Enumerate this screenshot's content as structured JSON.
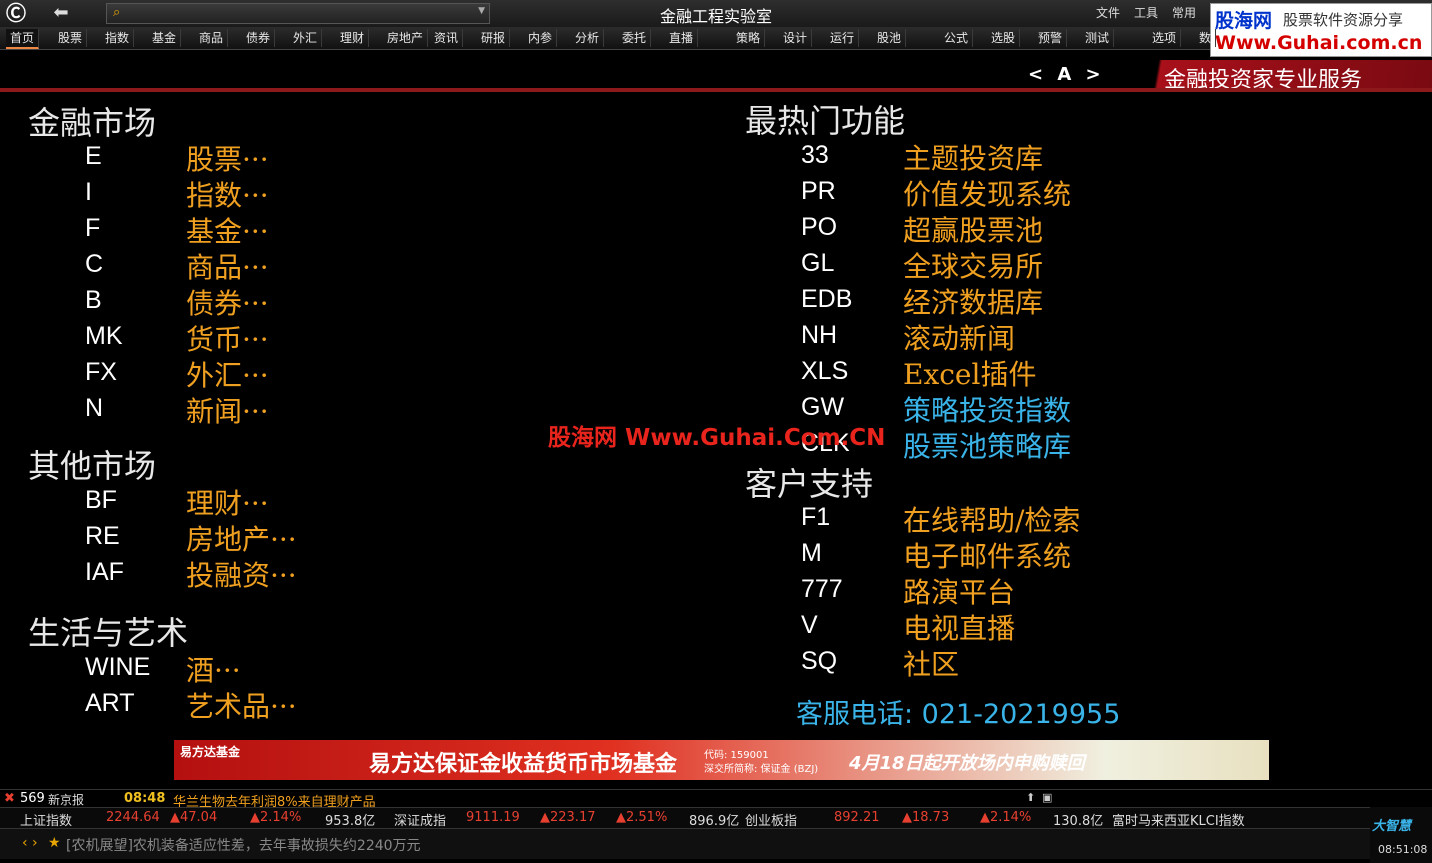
{
  "app": {
    "title": "金融工程实验室"
  },
  "top_menu": [
    "文件",
    "工具",
    "常用"
  ],
  "search": {
    "placeholder": ""
  },
  "brand": {
    "line1": "股海网",
    "line2": "股票软件资源分享",
    "line3": "Www.Guhai.com.cn"
  },
  "tabs": [
    "首页",
    "股票",
    "指数",
    "基金",
    "商品",
    "债券",
    "外汇",
    "理财",
    "房地产",
    "资讯",
    "研报",
    "内参",
    "分析",
    "委托",
    "直播",
    "策略",
    "设计",
    "运行",
    "股池",
    "公式",
    "选股",
    "预警",
    "测试",
    "选项",
    "数"
  ],
  "header": {
    "page_nav": "< A >",
    "banner": "金融投资家专业服务"
  },
  "sections": {
    "financial_markets": {
      "title": "金融市场",
      "items": [
        {
          "code": "E",
          "label": "股票···"
        },
        {
          "code": "I",
          "label": "指数···"
        },
        {
          "code": "F",
          "label": "基金···"
        },
        {
          "code": "C",
          "label": "商品···"
        },
        {
          "code": "B",
          "label": "债券···"
        },
        {
          "code": "MK",
          "label": "货币···"
        },
        {
          "code": "FX",
          "label": "外汇···"
        },
        {
          "code": "N",
          "label": "新闻···"
        }
      ]
    },
    "other_markets": {
      "title": "其他市场",
      "items": [
        {
          "code": "BF",
          "label": "理财···"
        },
        {
          "code": "RE",
          "label": "房地产···"
        },
        {
          "code": "IAF",
          "label": "投融资···"
        }
      ]
    },
    "life_art": {
      "title": "生活与艺术",
      "items": [
        {
          "code": "WINE",
          "label": "酒···"
        },
        {
          "code": "ART",
          "label": "艺术品···"
        }
      ]
    },
    "hot_functions": {
      "title": "最热门功能",
      "items": [
        {
          "code": "33",
          "label": "主题投资库"
        },
        {
          "code": "PR",
          "label": "价值发现系统"
        },
        {
          "code": "PO",
          "label": "超赢股票池"
        },
        {
          "code": "GL",
          "label": "全球交易所"
        },
        {
          "code": "EDB",
          "label": "经济数据库"
        },
        {
          "code": "NH",
          "label": "滚动新闻"
        },
        {
          "code": "XLS",
          "label": "Excel插件"
        },
        {
          "code": "GW",
          "label": "策略投资指数"
        },
        {
          "code": "CLK",
          "label": "股票池策略库"
        }
      ]
    },
    "support": {
      "title": "客户支持",
      "items": [
        {
          "code": "F1",
          "label": "在线帮助/检索"
        },
        {
          "code": "M",
          "label": "电子邮件系统"
        },
        {
          "code": "777",
          "label": "路演平台"
        },
        {
          "code": "V",
          "label": "电视直播"
        },
        {
          "code": "SQ",
          "label": "社区"
        }
      ]
    }
  },
  "watermark": "股海网 Www.Guhai.Com.CN",
  "hotline": "客服电话: 021-20219955",
  "ad": {
    "logo": "易方达基金",
    "main": "易方达保证金收益货币市场基金",
    "code": "代码: 159001",
    "short": "深交所简称: 保证金 (BZJ)",
    "right": "4月18日起开放场内申购赎回"
  },
  "news": {
    "count": "569",
    "source": "新京报",
    "time": "08:48",
    "headline": "华兰生物去年利润8%来自理财产品"
  },
  "indices": [
    {
      "name": "上证指数",
      "value": "2244.64",
      "change": "▲47.04",
      "pct": "▲2.14%",
      "amount": "953.8亿"
    },
    {
      "name": "深证成指",
      "value": "9111.19",
      "change": "▲223.17",
      "pct": "▲2.51%",
      "amount": "896.9亿"
    },
    {
      "name": "创业板指",
      "value": "892.21",
      "change": "▲18.73",
      "pct": "▲2.14%",
      "amount": "130.8亿"
    },
    {
      "name": "富时马来西亚KLCI指数",
      "value": "",
      "change": "",
      "pct": "",
      "amount": ""
    }
  ],
  "bottom_news": "[农机展望]农机装备适应性差，去年事故损失约2240万元",
  "clock": "08:51:08",
  "corner_brand": "大智慧",
  "colors": {
    "accent": "#f0a020",
    "link_blue": "#3ab4e8",
    "up_red": "#e84030",
    "banner_red": "#a8101a"
  }
}
